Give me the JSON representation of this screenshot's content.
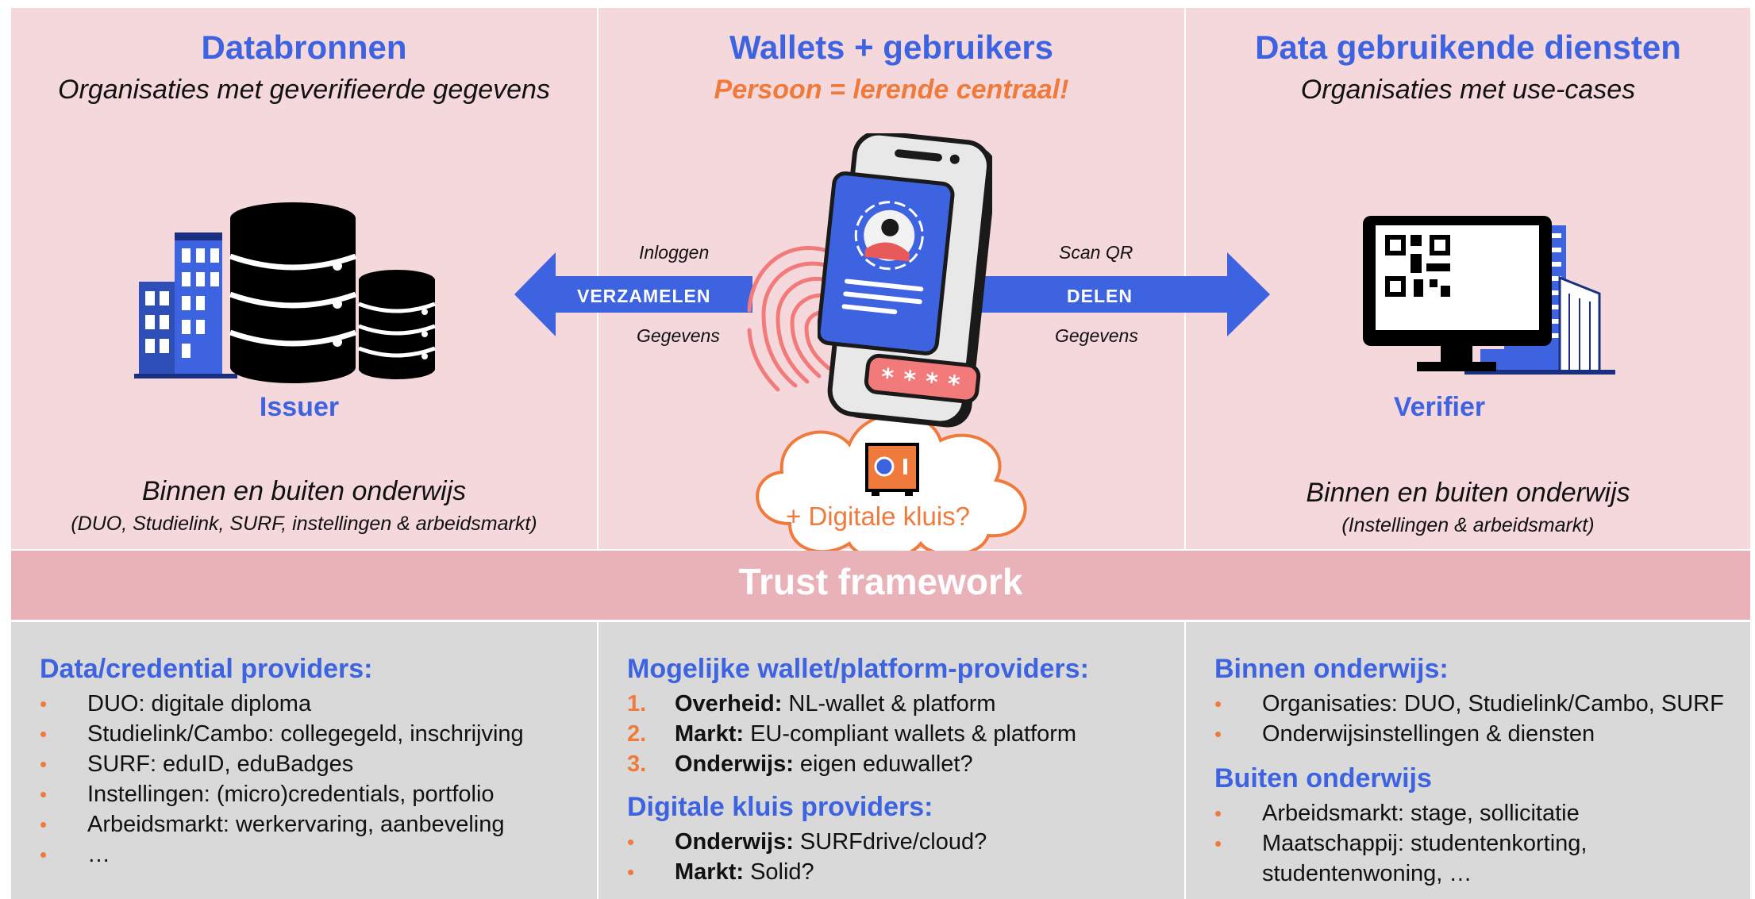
{
  "columns": {
    "left": {
      "title": "Databronnen",
      "subtitle": "Organisaties met geverifieerde gegevens",
      "role": "Issuer",
      "scope": "Binnen en buiten onderwijs",
      "scope_detail": "(DUO, Studielink, SURF, instellingen & arbeidsmarkt)"
    },
    "middle": {
      "title": "Wallets + gebruikers",
      "subtitle": "Persoon = lerende centraal!",
      "vault_label": "+ Digitale kluis?"
    },
    "right": {
      "title": "Data gebruikende diensten",
      "subtitle": "Organisaties met use-cases",
      "role": "Verifier",
      "scope": "Binnen en buiten onderwijs",
      "scope_detail": "(Instellingen & arbeidsmarkt)"
    }
  },
  "arrows": {
    "left": {
      "top": "Inloggen",
      "word": "VERZAMELEN",
      "bottom": "Gegevens"
    },
    "right": {
      "top": "Scan QR",
      "word": "DELEN",
      "bottom": "Gegevens"
    }
  },
  "trust_framework": "Trust framework",
  "bottom": {
    "left": {
      "heading": "Data/credential providers:",
      "items": [
        "DUO: digitale diploma",
        "Studielink/Cambo: collegegeld, inschrijving",
        "SURF: eduID, eduBadges",
        "Instellingen: (micro)credentials, portfolio",
        "Arbeidsmarkt: werkervaring, aanbeveling",
        "…"
      ]
    },
    "middle": {
      "heading1": "Mogelijke wallet/platform-providers:",
      "numbered": [
        {
          "num": "1.",
          "bold": "Overheid:",
          "text": " NL-wallet & platform"
        },
        {
          "num": "2.",
          "bold": "Markt:",
          "text": " EU-compliant wallets & platform"
        },
        {
          "num": "3.",
          "bold": "Onderwijs:",
          "text": " eigen eduwallet?"
        }
      ],
      "heading2": "Digitale kluis providers:",
      "items": [
        {
          "bold": "Onderwijs:",
          "text": " SURFdrive/cloud?"
        },
        {
          "bold": "Markt:",
          "text": " Solid?"
        }
      ]
    },
    "right": {
      "heading1": "Binnen onderwijs:",
      "items1": [
        "Organisaties: DUO, Studielink/Cambo, SURF",
        "Onderwijsinstellingen & diensten"
      ],
      "heading2": "Buiten onderwijs",
      "items2": [
        "Arbeidsmarkt: stage, sollicitatie",
        "Maatschappij: studentenkorting, studentenwoning, …"
      ]
    }
  },
  "colors": {
    "accent_blue": "#3d63e0",
    "accent_orange": "#f07a3c",
    "top_panel": "#f4d8dc",
    "trust_band": "#e8b2b8",
    "bottom_panel": "#d9d9d9"
  },
  "icons": [
    "database-icon",
    "building-icon",
    "smartphone-icon",
    "fingerprint-icon",
    "cloud-icon",
    "safe-icon",
    "monitor-qr-icon",
    "office-building-icon"
  ]
}
